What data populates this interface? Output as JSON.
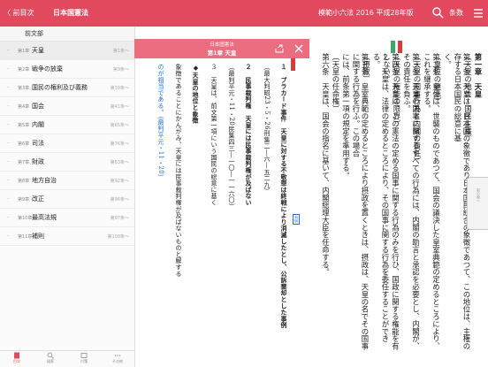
{
  "header": {
    "back_label": "〈 前目次",
    "left_title": "日本国憲法",
    "book_title": "模範小六法 2016 平成28年版",
    "article_label": "条数"
  },
  "toc": {
    "head": "前文部",
    "items": [
      {
        "chapter": "第1章",
        "name": "天皇",
        "range": "第1条〜",
        "active": true
      },
      {
        "chapter": "第2章",
        "name": "戦争の放棄",
        "range": "第9条〜"
      },
      {
        "chapter": "第3章",
        "name": "国民の権利及び義務",
        "range": "第10条〜"
      },
      {
        "chapter": "第4章",
        "name": "国会",
        "range": "第41条〜"
      },
      {
        "chapter": "第5章",
        "name": "内閣",
        "range": "第65条〜"
      },
      {
        "chapter": "第6章",
        "name": "司法",
        "range": "第76条〜"
      },
      {
        "chapter": "第7章",
        "name": "財政",
        "range": "第83条〜"
      },
      {
        "chapter": "第8章",
        "name": "地方自治",
        "range": "第92条〜"
      },
      {
        "chapter": "第9章",
        "name": "改正",
        "range": "第96条〜"
      },
      {
        "chapter": "第10章",
        "name": "最高法規",
        "range": "第97条〜"
      },
      {
        "chapter": "第11章",
        "name": "補則",
        "range": "第100条〜"
      }
    ]
  },
  "tabbar": {
    "tabs": [
      "目次",
      "検索",
      "付箋",
      "その他"
    ]
  },
  "popup": {
    "law": "日本国憲法",
    "chapter": "第1章 天皇",
    "lines": [
      {
        "text": "１　プラカード事件　天皇に対する不敬罪は終戦により消滅したとし、公訴棄却とした事例",
        "bold": true
      },
      {
        "text": "（最大判昭23・5・26刑集二―六―五二九）"
      },
      {
        "text": "２　民事裁判権　天皇には民事裁判権が及ばない",
        "bold": true
      },
      {
        "text": "（最判平元・11・20民集四三―一〇―一一六〇）"
      },
      {
        "text": "３　天皇は、前文第一項にいう国民の総意に基く"
      },
      {
        "text": "◆天皇の地位と象徴",
        "bold": true
      },
      {
        "text": "象徴であることにかんがみ、天皇には民事裁判権が及ばないものと解する"
      },
      {
        "text": "のが相当である。（最判平元・11・20）",
        "link": true
      }
    ],
    "tag_label": "判例"
  },
  "main": {
    "columns": [
      {
        "text": "第一章　天皇",
        "head": true
      },
      {
        "text": "〔天皇の地位・国民主権〕"
      },
      {
        "text": "第一条　天皇は、日本国の象徴であり日本国民統合の象徴であつて、この地位は、主権の存する日本国民の総意に基"
      },
      {
        "text": "く。"
      },
      {
        "text": "〔皇位の継承〕"
      },
      {
        "text": "第二条　皇位は、世襲のものであつて、国会の議決した皇室典範の定めるところにより、これを継承する。"
      },
      {
        "text": "〔天皇の国事行為と内閣の責任〕"
      },
      {
        "text": "第三条　天皇の国事に関するすべての行為には、内閣の助言と承認を必要とし、内閣が、その責任を負ふ。"
      },
      {
        "text": "〔天皇の権能の限界〕"
      },
      {
        "text": "第四条　天皇は、この憲法の定める国事に関する行為のみを行ひ、国政に関する権能を有しない。"
      },
      {
        "text": "２　天皇は、法律の定めるところにより、その国事に関する行為を委任することができる。"
      },
      {
        "text": "〔摂政〕"
      },
      {
        "text": "第五条　皇室典範の定めるところにより摂政を置くときは、摂政は、天皇の名でその国事に関する行為を行ふ。この場合"
      },
      {
        "text": "には、前条第一項の規定を準用する。"
      },
      {
        "text": "〔天皇の任命権〕"
      },
      {
        "text": "第六条　天皇は、国会の指名に基いて、内閣総理大臣を任命する。"
      }
    ],
    "scroll_label": "前の章へ"
  },
  "colors": {
    "accent": "#e2495f",
    "popup_header": "#eb6d80",
    "link": "#1e6fd9",
    "green_flag": "#3aa86b",
    "red_flag": "#d93a3a"
  }
}
